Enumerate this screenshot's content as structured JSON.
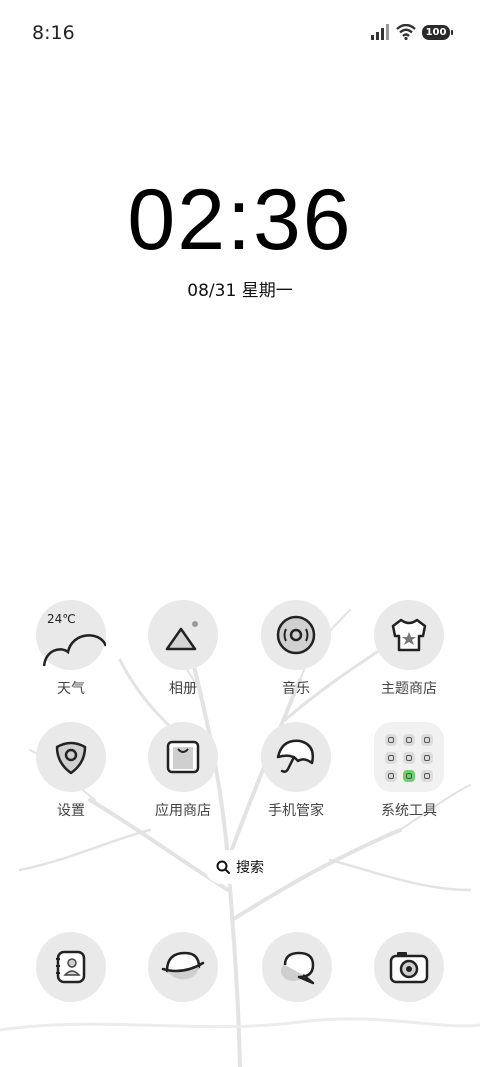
{
  "status_bar": {
    "time": "8:16",
    "battery": "100",
    "icons": [
      "signal-icon",
      "wifi-icon",
      "battery-icon"
    ]
  },
  "clock_widget": {
    "time": "02:36",
    "date": "08/31 星期一"
  },
  "apps": [
    {
      "label": "天气",
      "icon": "weather-cloud-icon",
      "temp": "24℃"
    },
    {
      "label": "相册",
      "icon": "gallery-icon"
    },
    {
      "label": "音乐",
      "icon": "music-disc-icon"
    },
    {
      "label": "主题商店",
      "icon": "theme-shirt-icon"
    },
    {
      "label": "设置",
      "icon": "settings-icon"
    },
    {
      "label": "应用商店",
      "icon": "app-store-bag-icon"
    },
    {
      "label": "手机管家",
      "icon": "umbrella-icon"
    },
    {
      "label": "系统工具",
      "icon": "folder-icon"
    }
  ],
  "search": {
    "label": "搜索",
    "icon": "search-icon"
  },
  "dock": [
    {
      "icon": "contacts-icon"
    },
    {
      "icon": "browser-icon"
    },
    {
      "icon": "messages-icon"
    },
    {
      "icon": "camera-icon"
    }
  ]
}
